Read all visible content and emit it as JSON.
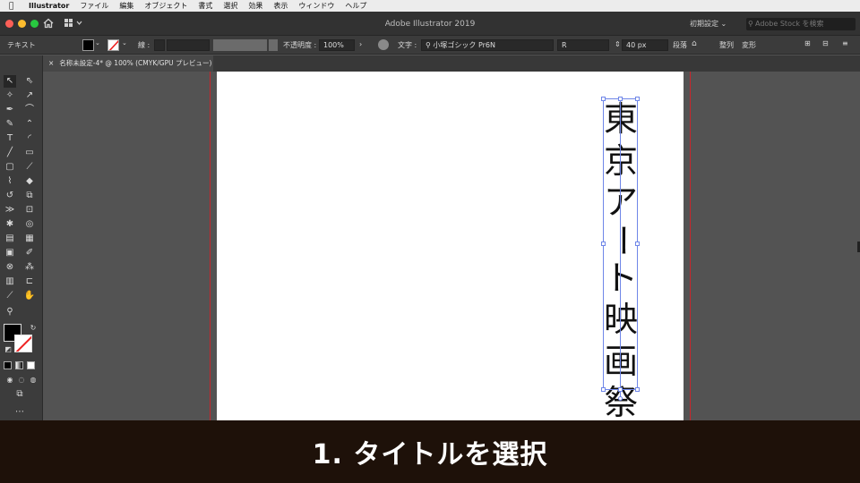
{
  "menubar": {
    "app_name": "Illustrator",
    "items": [
      "ファイル",
      "編集",
      "オブジェクト",
      "書式",
      "選択",
      "効果",
      "表示",
      "ウィンドウ",
      "ヘルプ"
    ]
  },
  "window": {
    "title": "Adobe Illustrator 2019",
    "workspace": "初期設定",
    "stock_search_placeholder": "Adobe Stock を検索"
  },
  "control": {
    "mode_label": "テキスト",
    "stroke_label": "線 :",
    "opacity_label": "不透明度 :",
    "opacity_value": "100%",
    "char_label": "文字 :",
    "font_name": "小塚ゴシック Pr6N",
    "font_style": "R",
    "font_size": "40 px",
    "paragraph_label": "段落",
    "align_label": "整列",
    "transform_label": "変形"
  },
  "document": {
    "tab_title": "名称未設定-4* @ 100% (CMYK/GPU プレビュー)"
  },
  "artwork": {
    "vertical_text": [
      "東",
      "京",
      "ア",
      "ー",
      "ト",
      "映",
      "画",
      "祭"
    ]
  },
  "caption": {
    "text": "1. タイトルを選択"
  }
}
